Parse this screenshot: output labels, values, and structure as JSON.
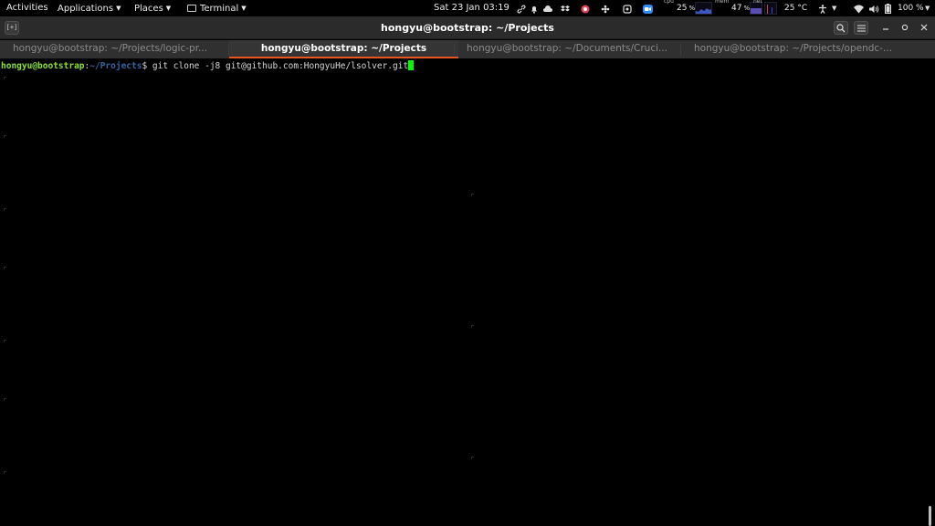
{
  "topbar": {
    "activities": "Activities",
    "applications": "Applications",
    "places": "Places",
    "terminal": "Terminal",
    "clock": "Sat 23 Jan  03:19",
    "cpu_label": "cpu",
    "cpu_value": "25",
    "cpu_unit": "%",
    "mem_label": "mem",
    "mem_value": "47",
    "mem_unit": "%",
    "net_label": "net",
    "temp": "25 °C",
    "battery": "100 %",
    "icons": [
      "link-icon",
      "bell-icon",
      "cloud-icon",
      "dropbox-icon",
      "app-icon",
      "flower-icon",
      "app-icon",
      "zoom-icon",
      "accessibility-icon",
      "wifi-icon",
      "volume-icon",
      "battery-icon",
      "power-icon"
    ],
    "accent_colors": {
      "zoom": "#2d8cff",
      "app_red": "#e8405a"
    }
  },
  "window": {
    "title": "hongyu@bootstrap: ~/Projects",
    "new_tab_icon": "[+]",
    "search_icon": "search-icon",
    "menu_icon": "hamburger-menu-icon"
  },
  "tabs": [
    {
      "label": "hongyu@bootstrap: ~/Projects/logic-pr...",
      "active": false
    },
    {
      "label": "hongyu@bootstrap: ~/Projects",
      "active": true
    },
    {
      "label": "hongyu@bootstrap: ~/Documents/Cruci...",
      "active": false
    },
    {
      "label": "hongyu@bootstrap: ~/Projects/opendc-...",
      "active": false
    }
  ],
  "terminal": {
    "user_host": "hongyu@bootstrap",
    "separator": ":",
    "path": "~/Projects",
    "prompt_symbol": "$",
    "command": " git clone -j8 git@github.com:HongyuHe/lsolver.git"
  },
  "colors": {
    "prompt_user": "#8ae234",
    "prompt_path": "#3465a4",
    "cursor": "#00ff00",
    "tab_accent": "#e95420",
    "background": "#000000"
  }
}
